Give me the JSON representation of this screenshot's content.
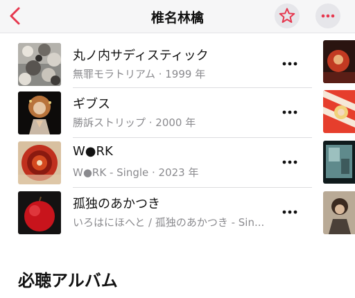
{
  "nav": {
    "title": "椎名林檎",
    "accent": "#e6384f"
  },
  "songs": [
    {
      "title": "丸ノ内サディスティック",
      "subtitle": "無罪モラトリアム · 1999 年"
    },
    {
      "title": "ギブス",
      "subtitle": "勝訴ストリップ · 2000 年"
    },
    {
      "title": "W●RK",
      "subtitle": "W●RK - Single · 2023 年"
    },
    {
      "title": "孤独のあかつき",
      "subtitle": "いろはにほへと / 孤独のあかつき - Sin..."
    }
  ],
  "section": {
    "title": "必聴アルバム"
  }
}
